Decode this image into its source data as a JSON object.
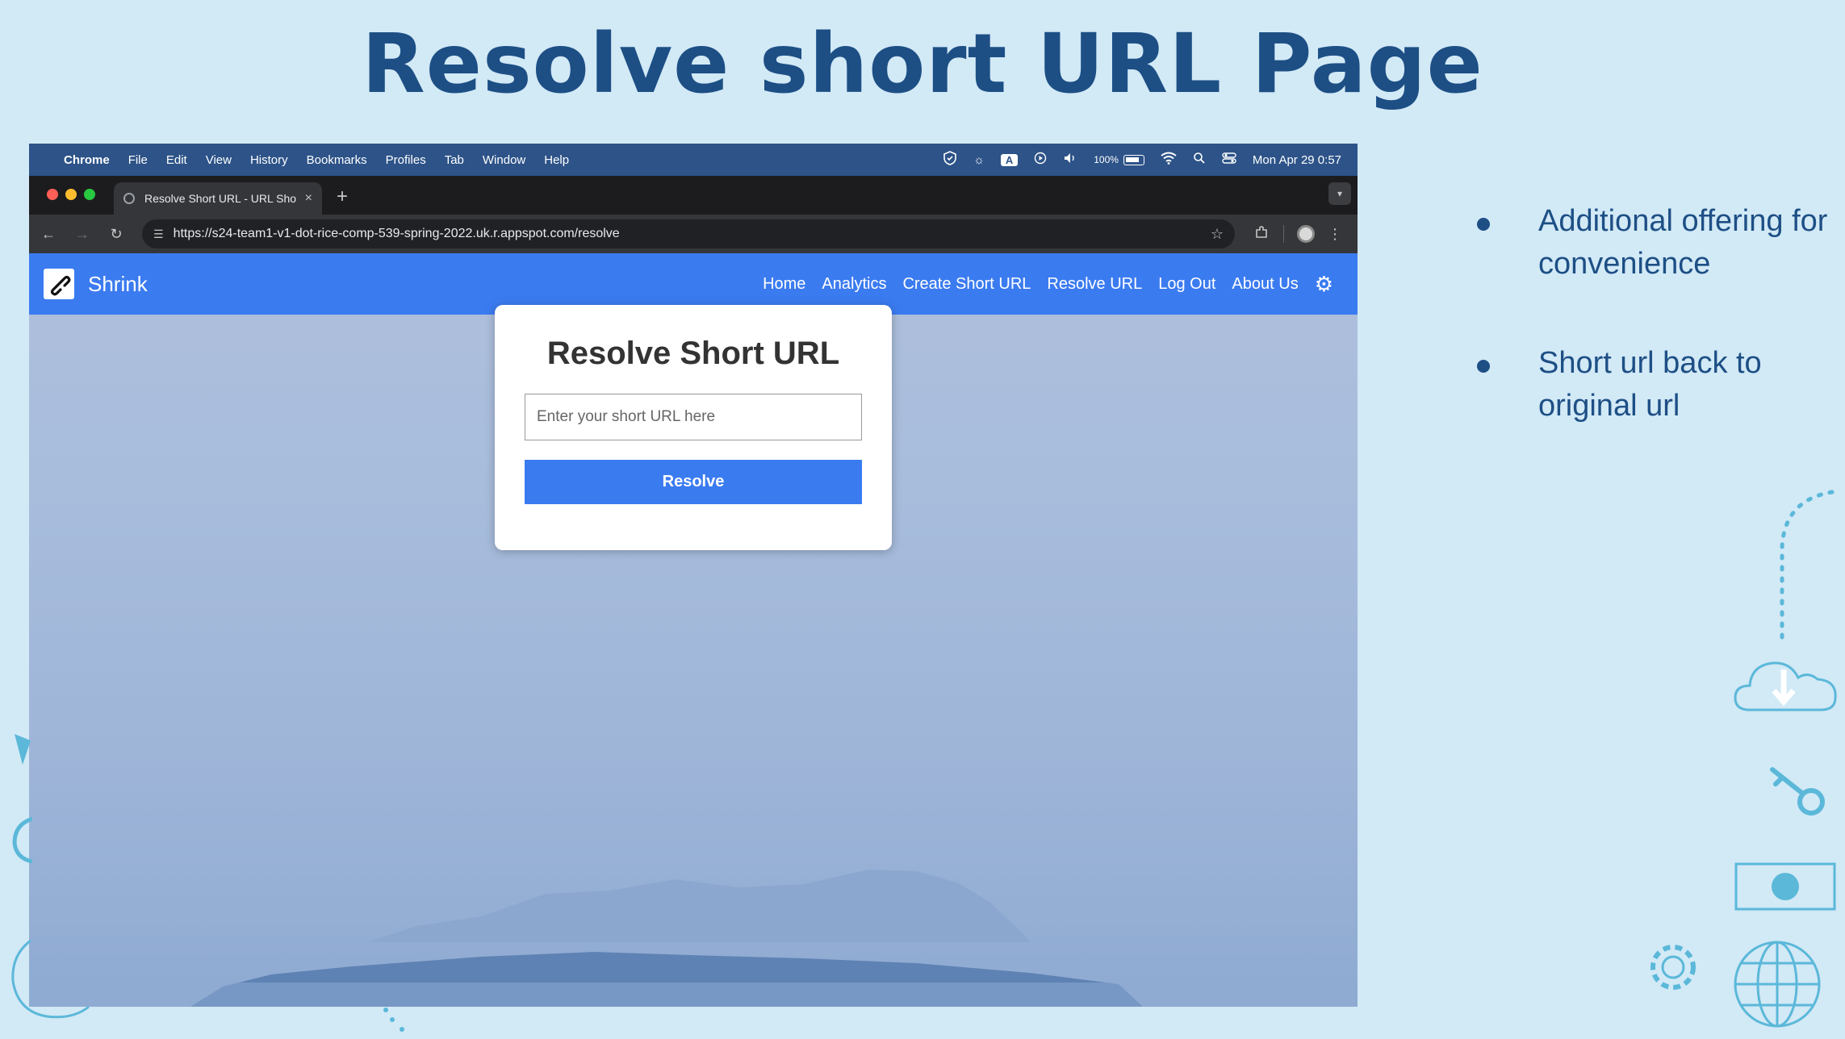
{
  "slide": {
    "title": "Resolve short URL Page",
    "bullets": [
      "Additional offering for convenience",
      "Short url back to original url"
    ]
  },
  "menubar": {
    "app": "Chrome",
    "items": [
      "File",
      "Edit",
      "View",
      "History",
      "Bookmarks",
      "Profiles",
      "Tab",
      "Window",
      "Help"
    ],
    "status_a": "A",
    "battery": "100%",
    "datetime": "Mon Apr 29  0:57"
  },
  "browser": {
    "tab_title": "Resolve Short URL - URL Sho",
    "tab_close": "×",
    "new_tab": "+",
    "url": "https://s24-team1-v1-dot-rice-comp-539-spring-2022.uk.r.appspot.com/resolve"
  },
  "site": {
    "brand": "Shrink",
    "nav": [
      "Home",
      "Analytics",
      "Create Short URL",
      "Resolve URL",
      "Log Out",
      "About Us"
    ]
  },
  "card": {
    "heading": "Resolve Short URL",
    "input_placeholder": "Enter your short URL here",
    "button": "Resolve"
  },
  "colors": {
    "slide_bg": "#d2e9f6",
    "title": "#1d4f85",
    "navbar": "#3b7bf0",
    "button": "#3b7bf0",
    "menubar": "#2d5388"
  },
  "icons": [
    "apple-icon",
    "shield-icon",
    "brightness-icon",
    "play-icon",
    "volume-icon",
    "battery-icon",
    "wifi-icon",
    "search-icon",
    "control-center-icon",
    "globe-icon",
    "close-icon",
    "back-arrow-icon",
    "forward-arrow-icon",
    "reload-icon",
    "tune-icon",
    "star-icon",
    "extensions-icon",
    "profile-icon",
    "more-icon",
    "link-logo-icon",
    "gear-icon",
    "cloud-download-icon",
    "key-icon",
    "toggle-icon",
    "globe-deco-icon"
  ]
}
